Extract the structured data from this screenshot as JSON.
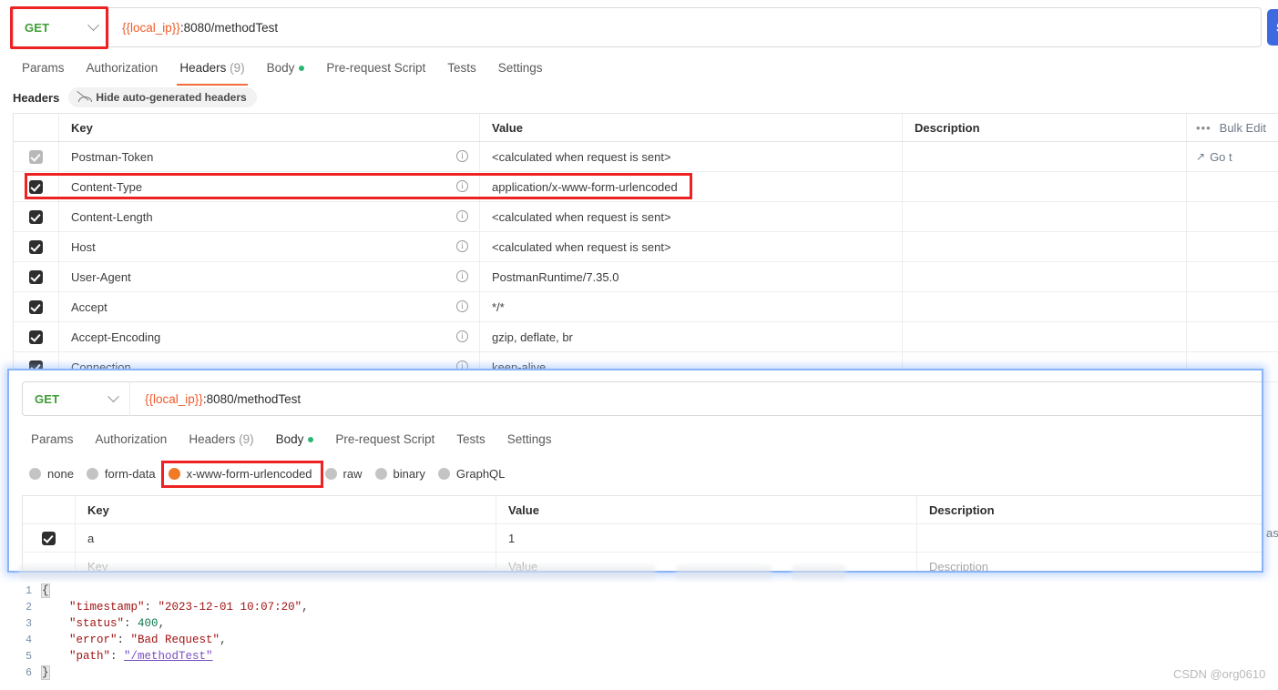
{
  "main_request": {
    "method": "GET",
    "url_variable": "{{local_ip}}",
    "url_rest": ":8080/methodTest",
    "send_label": "S",
    "tabs": [
      {
        "label": "Params",
        "active": false
      },
      {
        "label": "Authorization",
        "active": false
      },
      {
        "label": "Headers",
        "count": "(9)",
        "active": true
      },
      {
        "label": "Body",
        "dot": true,
        "active": false
      },
      {
        "label": "Pre-request Script",
        "active": false
      },
      {
        "label": "Tests",
        "active": false
      },
      {
        "label": "Settings",
        "active": false
      }
    ],
    "subbar": {
      "title": "Headers",
      "hide_auto_label": "Hide auto-generated headers"
    },
    "table": {
      "columns": [
        "Key",
        "Value",
        "Description"
      ],
      "bulk_edit_label": "Bulk Edit",
      "dots_label": "•••",
      "goto_label": "Go t",
      "rows": [
        {
          "checked": true,
          "disabled": true,
          "key": "Postman-Token",
          "value": "<calculated when request is sent>"
        },
        {
          "checked": true,
          "disabled": false,
          "key": "Content-Type",
          "value": "application/x-www-form-urlencoded",
          "highlight": true
        },
        {
          "checked": true,
          "disabled": false,
          "key": "Content-Length",
          "value": "<calculated when request is sent>"
        },
        {
          "checked": true,
          "disabled": false,
          "key": "Host",
          "value": "<calculated when request is sent>"
        },
        {
          "checked": true,
          "disabled": false,
          "key": "User-Agent",
          "value": "PostmanRuntime/7.35.0"
        },
        {
          "checked": true,
          "disabled": false,
          "key": "Accept",
          "value": "*/*"
        },
        {
          "checked": true,
          "disabled": false,
          "key": "Accept-Encoding",
          "value": "gzip, deflate, br"
        },
        {
          "checked": true,
          "disabled": false,
          "key": "Connection",
          "value": "keep-alive"
        }
      ]
    }
  },
  "overlay_panel": {
    "method": "GET",
    "url_variable": "{{local_ip}}",
    "url_rest": ":8080/methodTest",
    "tabs": [
      {
        "label": "Params",
        "active": false
      },
      {
        "label": "Authorization",
        "active": false
      },
      {
        "label": "Headers",
        "count": "(9)",
        "active": false
      },
      {
        "label": "Body",
        "dot": true,
        "active": true
      },
      {
        "label": "Pre-request Script",
        "active": false
      },
      {
        "label": "Tests",
        "active": false
      },
      {
        "label": "Settings",
        "active": false
      }
    ],
    "body_modes": [
      {
        "label": "none",
        "selected": false
      },
      {
        "label": "form-data",
        "selected": false
      },
      {
        "label": "x-www-form-urlencoded",
        "selected": true,
        "highlight": true
      },
      {
        "label": "raw",
        "selected": false
      },
      {
        "label": "binary",
        "selected": false
      },
      {
        "label": "GraphQL",
        "selected": false
      }
    ],
    "table": {
      "columns": [
        "Key",
        "Value",
        "Description"
      ],
      "rows": [
        {
          "checked": true,
          "key": "a",
          "value": "1",
          "description": ""
        }
      ],
      "placeholder_row": {
        "key": "Key",
        "value": "Value",
        "description": "Description"
      }
    },
    "ghost_text": "as"
  },
  "response_json": {
    "lines": [
      {
        "num": "1",
        "text": "{"
      },
      {
        "num": "2",
        "key": "\"timestamp\"",
        "value": "\"2023-12-01 10:07:20\"",
        "type": "string"
      },
      {
        "num": "3",
        "key": "\"status\"",
        "value": "400",
        "type": "number"
      },
      {
        "num": "4",
        "key": "\"error\"",
        "value": "\"Bad Request\"",
        "type": "string"
      },
      {
        "num": "5",
        "key": "\"path\"",
        "value": "\"/methodTest\"",
        "type": "link"
      },
      {
        "num": "6",
        "text": "}"
      }
    ]
  },
  "watermark": "CSDN @org0610",
  "colors": {
    "accent_orange": "#f26b3a",
    "method_green": "#3f9c35",
    "send_blue": "#3e6ae1",
    "highlight_red": "#ee2222",
    "panel_border_blue": "#8ab4f8",
    "radio_selected": "#f07a26"
  }
}
